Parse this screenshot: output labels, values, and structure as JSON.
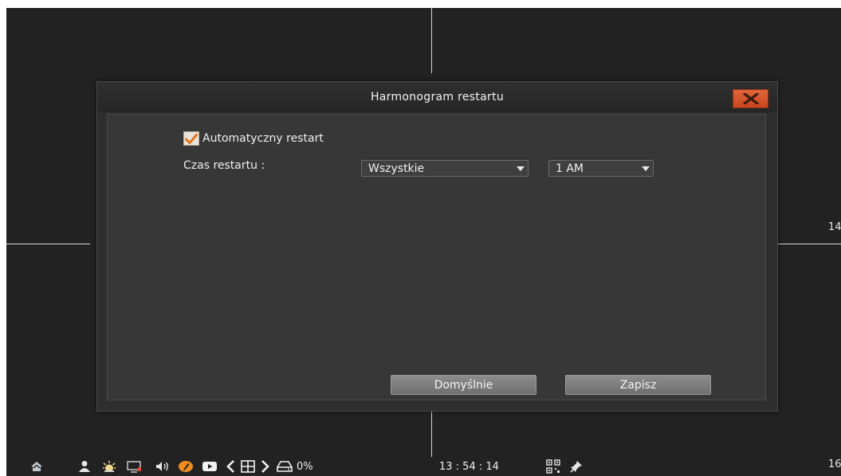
{
  "dialog": {
    "title": "Harmonogram restartu",
    "auto_restart": {
      "label": "Automatyczny restart",
      "checked": true
    },
    "restart_time_label": "Czas restartu :",
    "day_select": {
      "value": "Wszystkie"
    },
    "hour_select": {
      "value": "1 AM"
    },
    "default_button": "Domyślnie",
    "save_button": "Zapisz"
  },
  "channels": {
    "right_top": "14",
    "right_bottom": "16"
  },
  "taskbar": {
    "disk_usage": "0%",
    "clock": "13 : 54 : 14",
    "icons": [
      "home-icon",
      "user-icon",
      "alarm-icon",
      "display-icon",
      "volume-icon",
      "edit-icon",
      "playback-icon",
      "prev-icon",
      "layout-grid-icon",
      "next-icon",
      "disk-icon",
      "qr-code-icon",
      "pin-icon"
    ]
  },
  "colors": {
    "screen_bg": "#222222",
    "dialog_bg": "#2e2e2e",
    "close_button": "#d4552b",
    "button_bg": "#7d7d7d",
    "check_mark": "#e2721e"
  }
}
